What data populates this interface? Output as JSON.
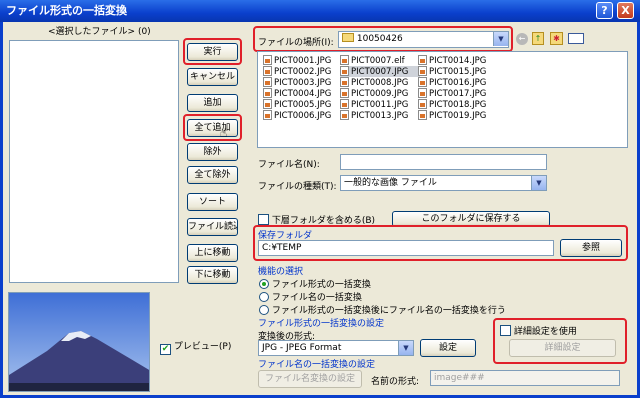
{
  "window": {
    "title": "ファイル形式の一括変換",
    "help_label": "?",
    "close_label": "X"
  },
  "selected_files": {
    "header": "<選択したファイル> (0)"
  },
  "buttons": {
    "run": "実行",
    "cancel": "キャンセル",
    "add": "追加",
    "add_all": "全て追加",
    "remove": "除外",
    "remove_all": "全て除外",
    "sort": "ソート",
    "load_file": "ファイル読込",
    "move_up": "上に移動",
    "move_down": "下に移動",
    "save_to_this_folder": "このフォルダに保存する",
    "browse": "参照",
    "settings": "設定",
    "advanced_settings": "詳細設定",
    "filename_convert_settings": "ファイル名変換の設定"
  },
  "location": {
    "label": "ファイルの場所(I):",
    "value": "10050426"
  },
  "files": {
    "col1": [
      "PICT0001.JPG",
      "PICT0002.JPG",
      "PICT0003.JPG",
      "PICT0004.JPG",
      "PICT0005.JPG",
      "PICT0006.JPG"
    ],
    "col2": [
      "PICT0007.elf",
      "PICT0007.JPG",
      "PICT0008.JPG",
      "PICT0009.JPG",
      "PICT0011.JPG",
      "PICT0013.JPG"
    ],
    "col3": [
      "PICT0014.JPG",
      "PICT0015.JPG",
      "PICT0016.JPG",
      "PICT0017.JPG",
      "PICT0018.JPG",
      "PICT0019.JPG"
    ],
    "selected": "PICT0007.JPG"
  },
  "filename": {
    "label": "ファイル名(N):",
    "value": ""
  },
  "filetype": {
    "label": "ファイルの種類(T):",
    "value": "一般的な画像 ファイル"
  },
  "subfolder": {
    "label": "下層フォルダを含める(B)"
  },
  "save_folder": {
    "label": "保存フォルダ",
    "value": "C:¥TEMP"
  },
  "mode": {
    "label": "機能の選択",
    "options": [
      "ファイル形式の一括変換",
      "ファイル名の一括変換",
      "ファイル形式の一括変換後にファイル名の一括変換を行う"
    ]
  },
  "format_section": {
    "label": "ファイル形式の一括変換の設定",
    "target_label": "変換後の形式:",
    "target_value": "JPG - JPEG Format"
  },
  "advanced": {
    "checkbox_label": "詳細設定を使用"
  },
  "rename_section": {
    "label": "ファイル名の一括変換の設定",
    "name_format_label": "名前の形式:",
    "name_format_value": "image###"
  },
  "preview": {
    "label": "プレビュー(P)"
  },
  "colors": {
    "highlight_red": "#e0202a",
    "title_blue": "#0a3fcc",
    "section_blue": "#0033cc"
  }
}
